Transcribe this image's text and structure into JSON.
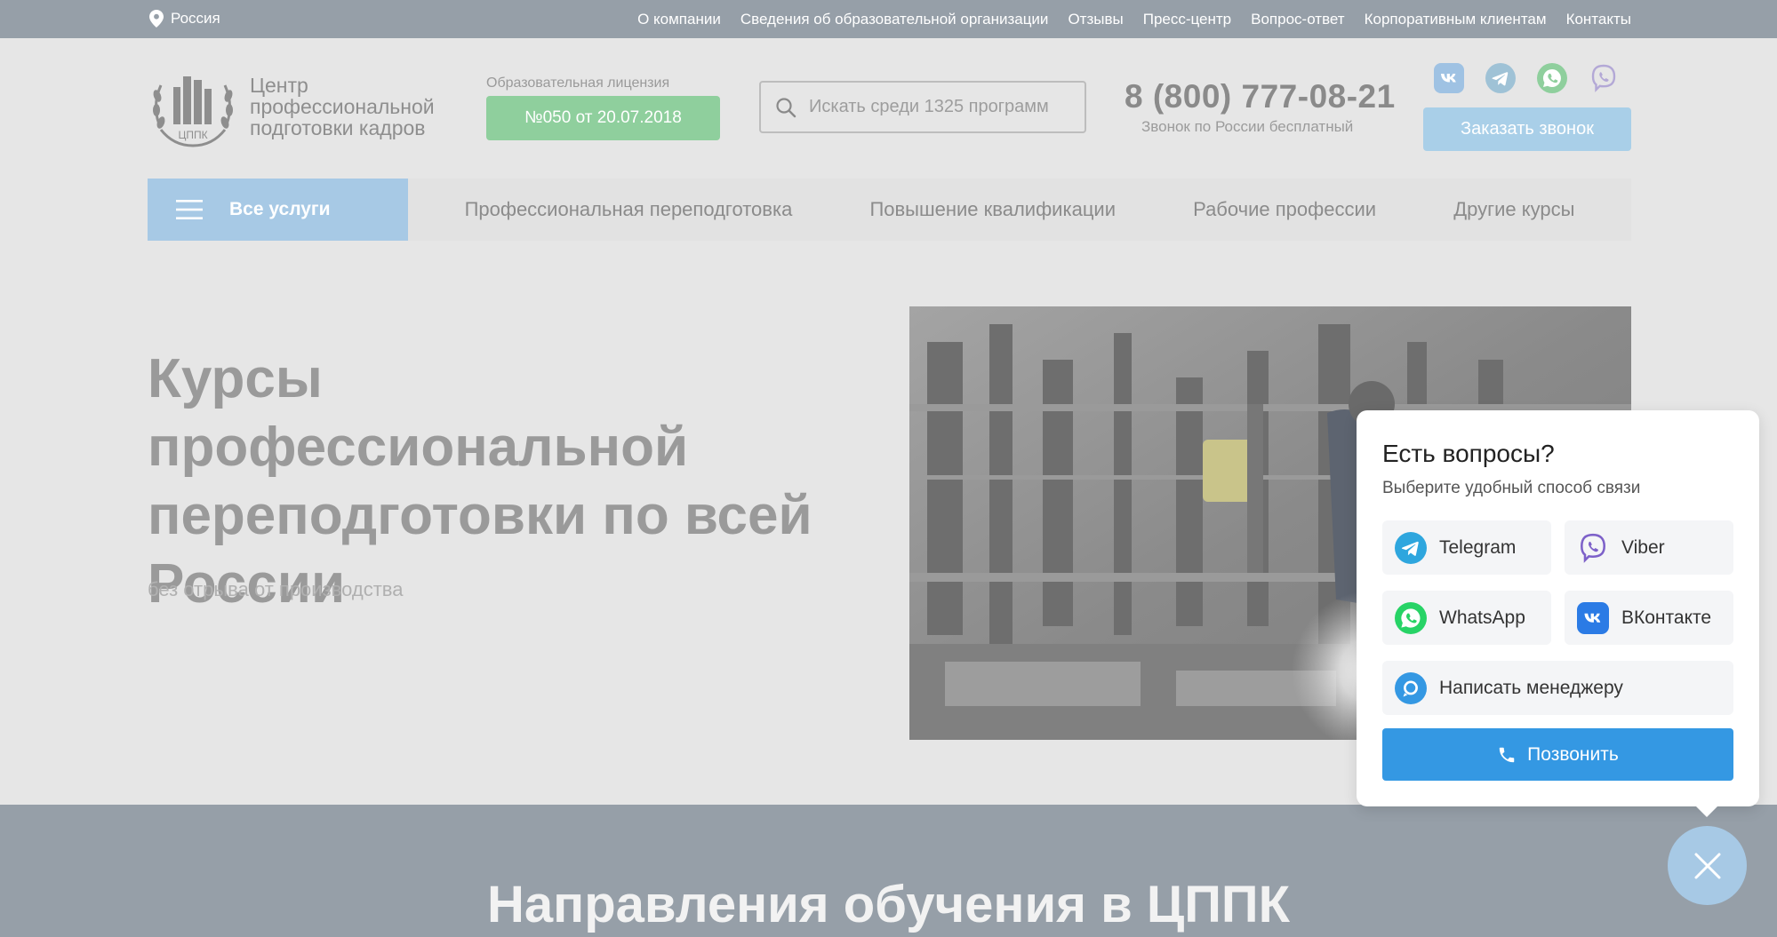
{
  "topbar": {
    "region": "Россия",
    "links": [
      "О компании",
      "Сведения об образовательной организации",
      "Отзывы",
      "Пресс-центр",
      "Вопрос-ответ",
      "Корпоративным клиентам",
      "Контакты"
    ]
  },
  "header": {
    "logo_lines": [
      "Центр",
      "профессиональной",
      "подготовки кадров"
    ],
    "logo_emblem_text": "ЦППК",
    "license_label": "Образовательная лицензия",
    "license_value": "№050 от 20.07.2018",
    "search_placeholder": "Искать среди 1325 программ",
    "phone": "8 (800) 777-08-21",
    "phone_note": "Звонок по России бесплатный",
    "callback_label": "Заказать звонок",
    "socials": [
      "vk-icon",
      "telegram-icon",
      "whatsapp-icon",
      "viber-icon"
    ]
  },
  "nav": {
    "all_services": "Все услуги",
    "links": [
      "Профессиональная переподготовка",
      "Повышение квалификации",
      "Рабочие профессии",
      "Другие курсы"
    ]
  },
  "hero": {
    "title": "Курсы профессиональной переподготовки по всей России",
    "subtitle": "без отрыва от производства"
  },
  "section": {
    "title": "Направления обучения в ЦППК"
  },
  "popup": {
    "title": "Есть вопросы?",
    "subtitle": "Выберите удобный способ связи",
    "options": [
      {
        "label": "Telegram",
        "icon": "telegram-icon"
      },
      {
        "label": "Viber",
        "icon": "viber-icon"
      },
      {
        "label": "WhatsApp",
        "icon": "whatsapp-icon"
      },
      {
        "label": "ВКонтакте",
        "icon": "vk-icon"
      },
      {
        "label": "Написать менеджеру",
        "icon": "chat-icon"
      }
    ],
    "call_label": "Позвонить"
  },
  "colors": {
    "topbar": "#969fa8",
    "accent_blue": "#3498e3",
    "license_green": "#8fcf9d",
    "telegram": "#2ea6de",
    "viber": "#7d61c9",
    "whatsapp": "#27d366",
    "vk": "#2b7be5"
  }
}
